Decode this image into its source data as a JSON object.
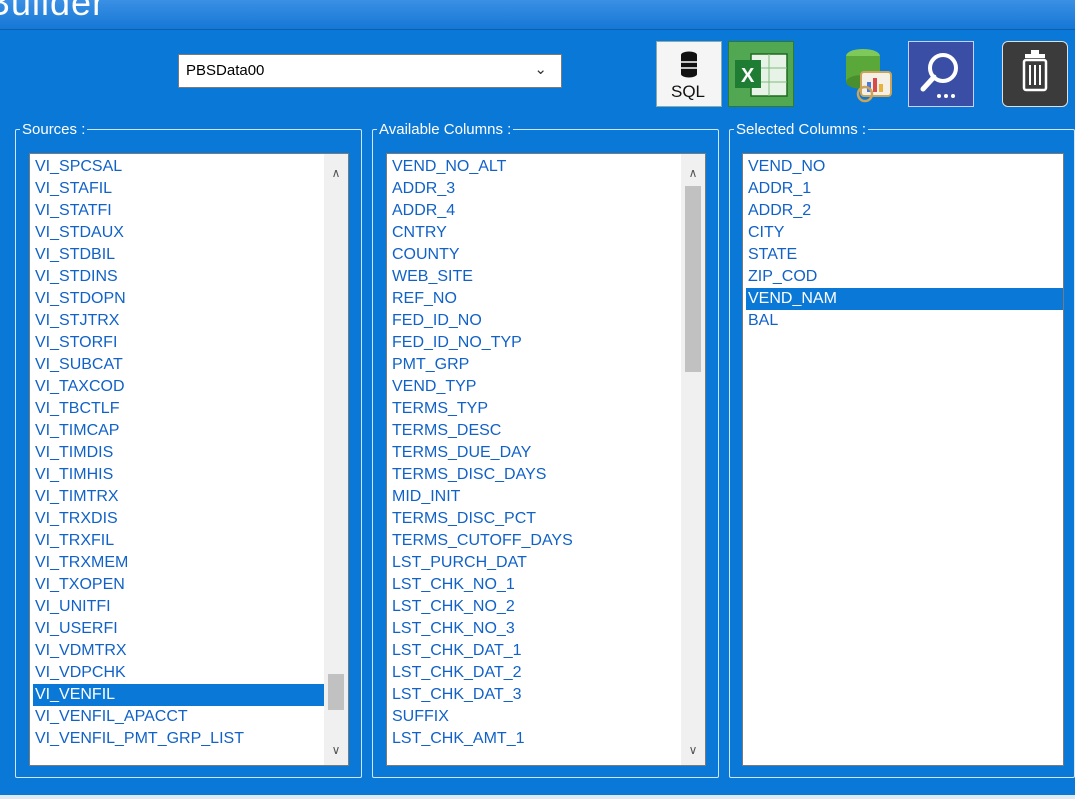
{
  "window": {
    "title": "Builder"
  },
  "database_select": {
    "value": "PBSData00"
  },
  "toolbar": {
    "sql_button": {
      "label": "SQL",
      "icon": "database-sql-icon"
    },
    "excel_button": {
      "icon": "excel-icon"
    },
    "query_button": {
      "icon": "database-chart-icon"
    },
    "search_button": {
      "icon": "search-icon"
    },
    "delete_button": {
      "icon": "trash-icon"
    }
  },
  "sources": {
    "label": "Sources :",
    "items": [
      "VI_SPCSAL",
      "VI_STAFIL",
      "VI_STATFI",
      "VI_STDAUX",
      "VI_STDBIL",
      "VI_STDINS",
      "VI_STDOPN",
      "VI_STJTRX",
      "VI_STORFI",
      "VI_SUBCAT",
      "VI_TAXCOD",
      "VI_TBCTLF",
      "VI_TIMCAP",
      "VI_TIMDIS",
      "VI_TIMHIS",
      "VI_TIMTRX",
      "VI_TRXDIS",
      "VI_TRXFIL",
      "VI_TRXMEM",
      "VI_TXOPEN",
      "VI_UNITFI",
      "VI_USERFI",
      "VI_VDMTRX",
      "VI_VDPCHK",
      "VI_VENFIL",
      "VI_VENFIL_APACCT",
      "VI_VENFIL_PMT_GRP_LIST"
    ],
    "selected": "VI_VENFIL"
  },
  "available_columns": {
    "label": "Available Columns :",
    "items": [
      "VEND_NO_ALT",
      "ADDR_3",
      "ADDR_4",
      "CNTRY",
      "COUNTY",
      "WEB_SITE",
      "REF_NO",
      "FED_ID_NO",
      "FED_ID_NO_TYP",
      "PMT_GRP",
      "VEND_TYP",
      "TERMS_TYP",
      "TERMS_DESC",
      "TERMS_DUE_DAY",
      "TERMS_DISC_DAYS",
      "MID_INIT",
      "TERMS_DISC_PCT",
      "TERMS_CUTOFF_DAYS",
      "LST_PURCH_DAT",
      "LST_CHK_NO_1",
      "LST_CHK_NO_2",
      "LST_CHK_NO_3",
      "LST_CHK_DAT_1",
      "LST_CHK_DAT_2",
      "LST_CHK_DAT_3",
      "SUFFIX",
      "LST_CHK_AMT_1"
    ]
  },
  "selected_columns": {
    "label": "Selected Columns :",
    "items": [
      "VEND_NO",
      "ADDR_1",
      "ADDR_2",
      "CITY",
      "STATE",
      "ZIP_COD",
      "VEND_NAM",
      "BAL"
    ],
    "selected": "VEND_NAM"
  },
  "colors": {
    "background": "#0a78d7",
    "selection": "#0a78d7",
    "item_text": "#1162c8"
  }
}
